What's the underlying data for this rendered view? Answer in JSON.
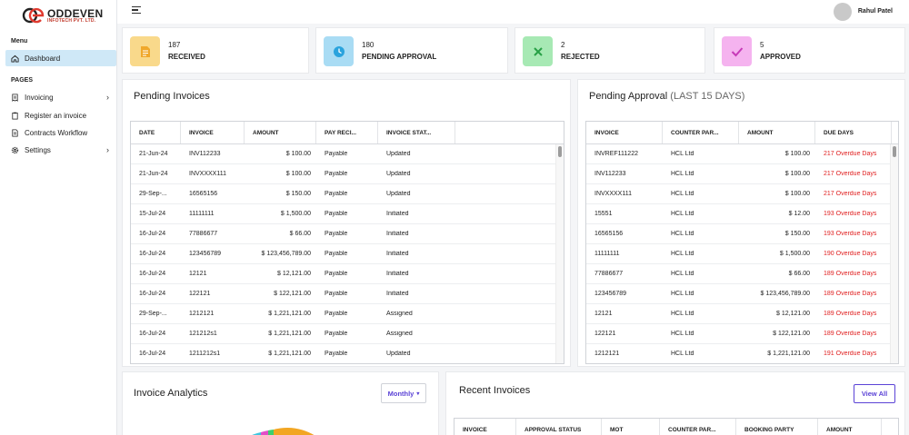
{
  "brand": {
    "name": "ODDEVEN",
    "sub": "INFOTECH PVT. LTD."
  },
  "sidebar": {
    "menu_label": "Menu",
    "pages_label": "PAGES",
    "dashboard": "Dashboard",
    "items": [
      {
        "label": "Invoicing",
        "has_chevron": true
      },
      {
        "label": "Register an invoice",
        "has_chevron": false
      },
      {
        "label": "Contracts Workflow",
        "has_chevron": false
      },
      {
        "label": "Settings",
        "has_chevron": true
      }
    ]
  },
  "topbar": {
    "user_name": "Rahul Patel"
  },
  "stats": [
    {
      "count": "187",
      "label": "RECEIVED",
      "icon": "document-icon",
      "color": "#f9d98b"
    },
    {
      "count": "180",
      "label": "PENDING APPROVAL",
      "icon": "clock-icon",
      "color": "#a9dcf4"
    },
    {
      "count": "2",
      "label": "REJECTED",
      "icon": "x-icon",
      "color": "#a7e9b4"
    },
    {
      "count": "5",
      "label": "APPROVED",
      "icon": "check-icon",
      "color": "#f5b3ef"
    }
  ],
  "pending_invoices": {
    "title": "Pending Invoices",
    "columns": [
      "DATE",
      "INVOICE",
      "AMOUNT",
      "PAY RECI...",
      "INVOICE STAT..."
    ],
    "rows": [
      [
        "21-Jun-24",
        "INV112233",
        "$ 100.00",
        "Payable",
        "Updated"
      ],
      [
        "21-Jun-24",
        "INVXXXX111",
        "$ 100.00",
        "Payable",
        "Updated"
      ],
      [
        "29-Sep-...",
        "16565156",
        "$ 150.00",
        "Payable",
        "Updated"
      ],
      [
        "15-Jul-24",
        "11111111",
        "$ 1,500.00",
        "Payable",
        "Initiated"
      ],
      [
        "16-Jul-24",
        "77886677",
        "$ 66.00",
        "Payable",
        "Initiated"
      ],
      [
        "16-Jul-24",
        "123456789",
        "$ 123,456,789.00",
        "Payable",
        "Initiated"
      ],
      [
        "16-Jul-24",
        "12121",
        "$ 12,121.00",
        "Payable",
        "Initiated"
      ],
      [
        "16-Jul-24",
        "122121",
        "$ 122,121.00",
        "Payable",
        "Initiated"
      ],
      [
        "29-Sep-...",
        "1212121",
        "$ 1,221,121.00",
        "Payable",
        "Assigned"
      ],
      [
        "16-Jul-24",
        "121212s1",
        "$ 1,221,121.00",
        "Payable",
        "Assigned"
      ],
      [
        "16-Jul-24",
        "1211212s1",
        "$ 1,221,121.00",
        "Payable",
        "Updated"
      ]
    ]
  },
  "pending_approval": {
    "title": "Pending Approval",
    "title_suffix": "(LAST 15 DAYS)",
    "columns": [
      "INVOICE",
      "COUNTER PAR...",
      "AMOUNT",
      "DUE DAYS"
    ],
    "rows": [
      [
        "INVREF111222",
        "HCL Ltd",
        "$ 100.00",
        "217 Overdue Days"
      ],
      [
        "INV112233",
        "HCL Ltd",
        "$ 100.00",
        "217 Overdue Days"
      ],
      [
        "INVXXXX111",
        "HCL Ltd",
        "$ 100.00",
        "217 Overdue Days"
      ],
      [
        "15551",
        "HCL Ltd",
        "$ 12.00",
        "193 Overdue Days"
      ],
      [
        "16565156",
        "HCL Ltd",
        "$ 150.00",
        "193 Overdue Days"
      ],
      [
        "11111111",
        "HCL Ltd",
        "$ 1,500.00",
        "190 Overdue Days"
      ],
      [
        "77886677",
        "HCL Ltd",
        "$ 66.00",
        "189 Overdue Days"
      ],
      [
        "123456789",
        "HCL Ltd",
        "$ 123,456,789.00",
        "189 Overdue Days"
      ],
      [
        "12121",
        "HCL Ltd",
        "$ 12,121.00",
        "189 Overdue Days"
      ],
      [
        "122121",
        "HCL Ltd",
        "$ 122,121.00",
        "189 Overdue Days"
      ],
      [
        "1212121",
        "HCL Ltd",
        "$ 1,221,121.00",
        "191 Overdue Days"
      ]
    ]
  },
  "invoice_analytics": {
    "title": "Invoice Analytics",
    "period": "Monthly"
  },
  "recent_invoices": {
    "title": "Recent Invoices",
    "view_all": "View All",
    "columns": [
      "INVOICE",
      "APPROVAL STATUS",
      "MOT",
      "COUNTER PAR...",
      "BOOKING PARTY",
      "AMOUNT"
    ]
  }
}
